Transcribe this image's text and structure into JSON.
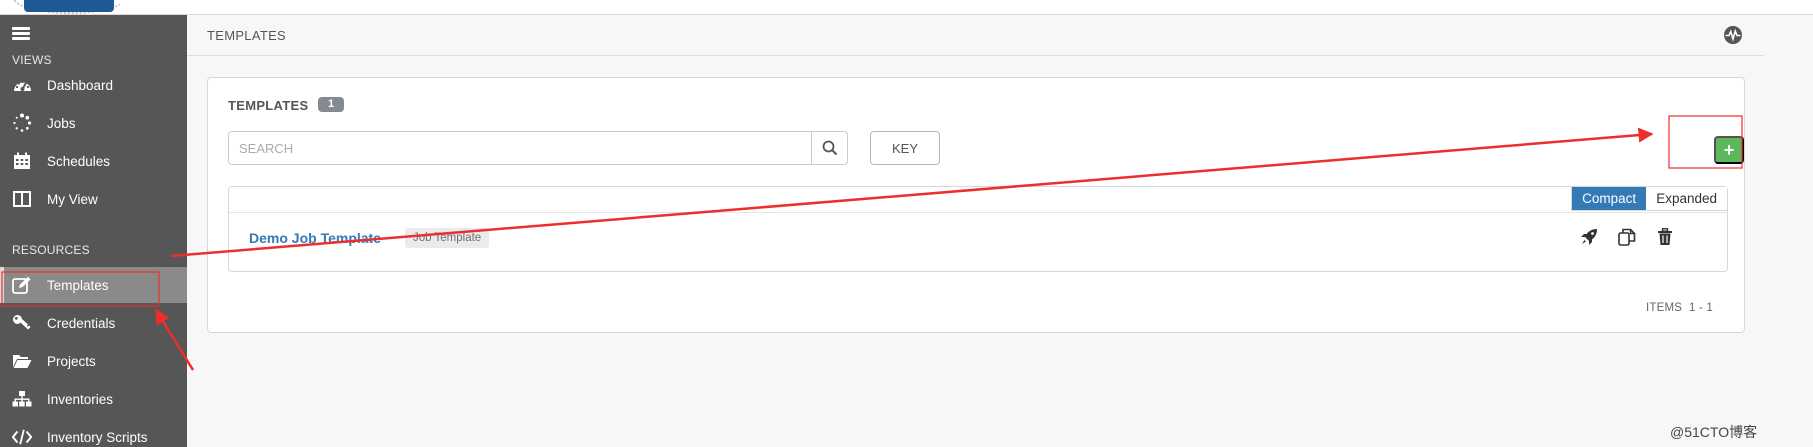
{
  "sidebar": {
    "views_label": "VIEWS",
    "resources_label": "RESOURCES",
    "items": [
      {
        "label": "Dashboard",
        "icon": "dashboard-icon"
      },
      {
        "label": "Jobs",
        "icon": "jobs-spinner-icon"
      },
      {
        "label": "Schedules",
        "icon": "calendar-icon"
      },
      {
        "label": "My View",
        "icon": "columns-icon"
      },
      {
        "label": "Templates",
        "icon": "edit-icon",
        "active": true
      },
      {
        "label": "Credentials",
        "icon": "key-icon"
      },
      {
        "label": "Projects",
        "icon": "folder-open-icon"
      },
      {
        "label": "Inventories",
        "icon": "sitemap-icon"
      },
      {
        "label": "Inventory Scripts",
        "icon": "code-icon"
      }
    ]
  },
  "header": {
    "breadcrumb": "TEMPLATES",
    "activity_icon": "activity-stream-icon"
  },
  "panel": {
    "title": "TEMPLATES",
    "count": "1",
    "search_placeholder": "SEARCH",
    "key_label": "KEY",
    "add_label": "+",
    "view_options": [
      "Compact",
      "Expanded"
    ],
    "selected_view": "Compact",
    "rows": [
      {
        "name": "Demo Job Template",
        "type": "Job Template",
        "actions": [
          "launch-rocket-icon",
          "copy-icon",
          "delete-trash-icon"
        ]
      }
    ],
    "items_label": "ITEMS",
    "items_range": "1 - 1"
  },
  "watermark": "@51CTO博客",
  "colors": {
    "sidebar_bg": "#565656",
    "active_item_bg": "#8a8a8a",
    "link_blue": "#337ab7",
    "add_green": "#5cb85c",
    "annotation_red": "#ee2d2d"
  }
}
